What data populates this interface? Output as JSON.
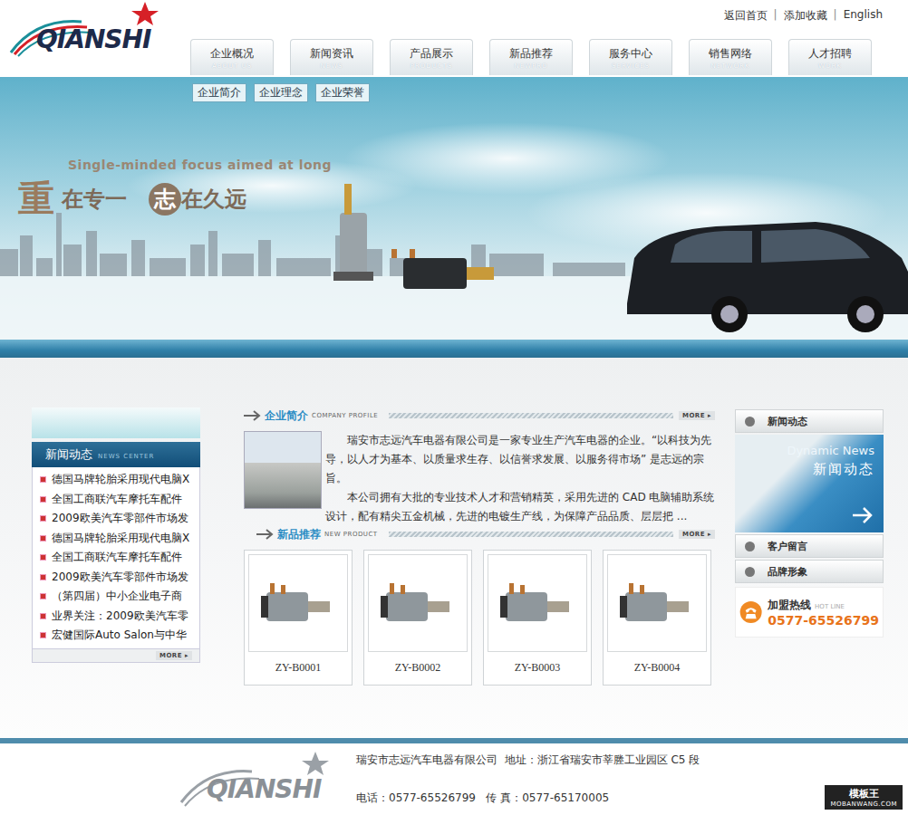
{
  "header": {
    "logo": "QIANSHI",
    "top_links": [
      "返回首页",
      "添加收藏",
      "English"
    ],
    "separator": "|"
  },
  "nav": [
    {
      "label": "企业概况",
      "sub": "ABOUT US",
      "selected": false
    },
    {
      "label": "新闻资讯",
      "sub": "NEWS",
      "selected": false
    },
    {
      "label": "产品展示",
      "sub": "PRODUCTS",
      "selected": false
    },
    {
      "label": "新品推荐",
      "sub": "NEWPRO",
      "selected": false
    },
    {
      "label": "服务中心",
      "sub": "SERVICES",
      "selected": false
    },
    {
      "label": "销售网络",
      "sub": "NETWORK",
      "selected": false
    },
    {
      "label": "人才招聘",
      "sub": "WORK",
      "selected": false
    }
  ],
  "subnav": [
    "企业简介",
    "企业理念",
    "企业荣誉"
  ],
  "banner": {
    "slogan_en": "Single-minded focus aimed at long",
    "slogan_cn": [
      {
        "text": "重",
        "kind": "big"
      },
      {
        "text": "在专一",
        "kind": "plain"
      },
      {
        "text": "志",
        "kind": "circle"
      },
      {
        "text": "在久远",
        "kind": "plain"
      }
    ]
  },
  "news": {
    "title": "新闻动态",
    "subtitle": "NEWS CENTER",
    "more": "MORE",
    "items": [
      "德国马牌轮胎采用现代电脑X",
      "全国工商联汽车摩托车配件",
      "2009欧美汽车零部件市场发",
      "德国马牌轮胎采用现代电脑X",
      "全国工商联汽车摩托车配件",
      "2009欧美汽车零部件市场发",
      "（第四届）中小企业电子商",
      "业界关注：2009欧美汽车零",
      "宏健国际Auto Salon与中华"
    ]
  },
  "profile": {
    "title": "企业简介",
    "subtitle": "COMPANY PROFILE",
    "more": "MORE",
    "paragraphs": [
      "瑞安市志远汽车电器有限公司是一家专业生产汽车电器的企业。“以科技为先导，以人才为基本、以质量求生存、以信誉求发展、以服务得市场” 是志远的宗旨。",
      "本公司拥有大批的专业技术人才和营销精英，采用先进的 CAD 电脑辅助系统设计，配有精尖五金机械，先进的电镀生产线，为保障产品品质、层层把 ..."
    ]
  },
  "products": {
    "title": "新品推荐",
    "subtitle": "NEW PRODUCT",
    "more": "MORE",
    "items": [
      "ZY-B0001",
      "ZY-B0002",
      "ZY-B0003",
      "ZY-B0004"
    ]
  },
  "sidebar": {
    "news_title": "新闻动态",
    "promo": {
      "title_en": "Dynamic News",
      "title_cn": "新闻动态"
    },
    "links": [
      "客户留言",
      "品牌形象"
    ]
  },
  "hotline": {
    "label": "加盟热线",
    "sub": "HOT LINE",
    "number": "0577-65526799"
  },
  "footer": {
    "logo": "QIANSHI",
    "line1": "瑞安市志远汽车电器有限公司  地址：浙江省瑞安市莘塍工业园区 C5 段",
    "line2": "电话：0577-65526799   传 真：0577-65170005"
  },
  "watermark": {
    "name": "模板王",
    "url": "MOBANWANG.COM"
  }
}
